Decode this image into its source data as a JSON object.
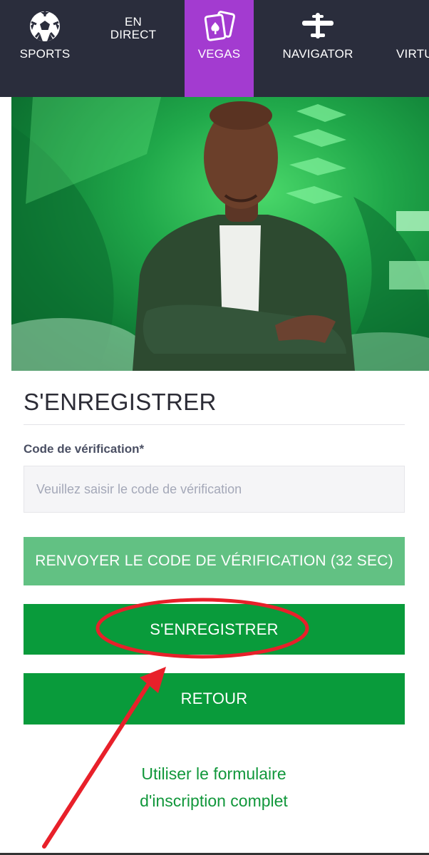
{
  "nav": {
    "items": [
      {
        "label": "SPORTS",
        "icon": "soccer-ball-icon",
        "active": false
      },
      {
        "label": "EN\nDIRECT",
        "icon": "",
        "active": false
      },
      {
        "label": "VEGAS",
        "icon": "playing-cards-icon",
        "active": true
      },
      {
        "label": "NAVIGATOR",
        "icon": "airplane-icon",
        "active": false
      },
      {
        "label": "VIRTU",
        "icon": "virtual-icon",
        "active": false
      }
    ],
    "colors": {
      "bar": "#2a2d3c",
      "active": "#a33bd0"
    }
  },
  "hero": {
    "alt": "promo-banner-person-green-background"
  },
  "form": {
    "title": "S'ENREGISTRER",
    "code_label": "Code de vérification*",
    "code_placeholder": "Veuillez saisir le code de vérification",
    "code_value": "",
    "resend_label": "RENVOYER LE CODE DE VÉRIFICATION (32 SEC)",
    "register_label": "S'ENREGISTRER",
    "back_label": "RETOUR",
    "full_form_link": "Utiliser le formulaire d'inscription complet"
  },
  "colors": {
    "primary_green": "#099b3b",
    "light_green": "#62c183",
    "link_green": "#11973b",
    "annotation_red": "#e8202a"
  }
}
